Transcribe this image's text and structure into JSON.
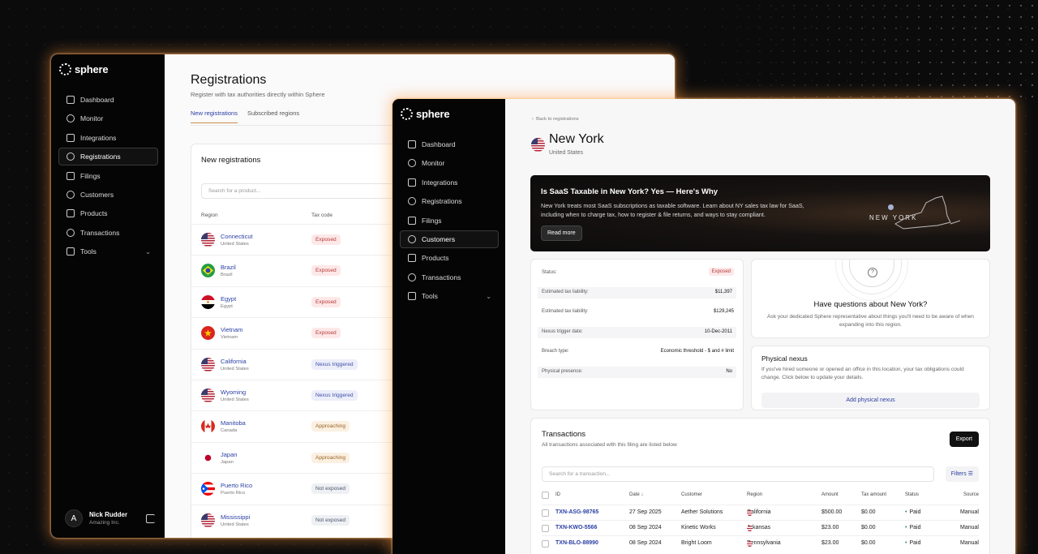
{
  "brand": {
    "name": "sphere"
  },
  "back": {
    "title": "Registrations",
    "subtitle": "Register with tax authorities directly within Sphere",
    "tabs": [
      {
        "label": "New registrations",
        "active": true
      },
      {
        "label": "Subscribed regions",
        "active": false
      }
    ],
    "card_title": "New registrations",
    "search_placeholder": "Search for a product...",
    "columns": [
      "Region",
      "Tax code"
    ],
    "rows": [
      {
        "name": "Connecticut",
        "country": "United States",
        "status": "Exposed",
        "flag": "us-flag"
      },
      {
        "name": "Brazil",
        "country": "Brazil",
        "status": "Exposed",
        "flag": "brazil-flag"
      },
      {
        "name": "Egypt",
        "country": "Egypt",
        "status": "Exposed",
        "flag": "egypt-flag"
      },
      {
        "name": "Vietnam",
        "country": "Vietnam",
        "status": "Exposed",
        "flag": "vietnam-flag"
      },
      {
        "name": "California",
        "country": "United States",
        "status": "Nexus triggered",
        "flag": "us-flag"
      },
      {
        "name": "Wyoming",
        "country": "United States",
        "status": "Nexus triggered",
        "flag": "us-flag"
      },
      {
        "name": "Manitoba",
        "country": "Canada",
        "status": "Approaching",
        "flag": "canada-flag"
      },
      {
        "name": "Japan",
        "country": "Japan",
        "status": "Approaching",
        "flag": "japan-flag"
      },
      {
        "name": "Puerto Rico",
        "country": "Puerto Rico",
        "status": "Not exposed",
        "flag": "puerto-rico-flag"
      },
      {
        "name": "Mississippi",
        "country": "United States",
        "status": "Not exposed",
        "flag": "us-flag"
      }
    ],
    "user": {
      "initial": "A",
      "name": "Nick Rudder",
      "org": "Amazing Inc."
    }
  },
  "nav_back": [
    {
      "label": "Dashboard",
      "icon": "home-icon"
    },
    {
      "label": "Monitor",
      "icon": "monitor-icon"
    },
    {
      "label": "Integrations",
      "icon": "grid-icon"
    },
    {
      "label": "Registrations",
      "icon": "location-pin-icon",
      "active": true
    },
    {
      "label": "Filings",
      "icon": "folder-icon"
    },
    {
      "label": "Customers",
      "icon": "users-icon"
    },
    {
      "label": "Products",
      "icon": "box-icon"
    },
    {
      "label": "Transactions",
      "icon": "dollar-icon"
    },
    {
      "label": "Tools",
      "icon": "wrench-icon",
      "has_chevron": true
    }
  ],
  "nav_front": [
    {
      "label": "Dashboard",
      "icon": "home-icon"
    },
    {
      "label": "Monitor",
      "icon": "monitor-icon"
    },
    {
      "label": "Integrations",
      "icon": "grid-icon"
    },
    {
      "label": "Registrations",
      "icon": "location-pin-icon"
    },
    {
      "label": "Filings",
      "icon": "folder-icon"
    },
    {
      "label": "Customers",
      "icon": "users-icon",
      "active": true
    },
    {
      "label": "Products",
      "icon": "box-icon"
    },
    {
      "label": "Transactions",
      "icon": "dollar-icon"
    },
    {
      "label": "Tools",
      "icon": "wrench-icon",
      "has_chevron": true
    }
  ],
  "front": {
    "back_link": "Back to registrations",
    "title": "New York",
    "subtitle": "United States",
    "banner": {
      "title": "Is SaaS Taxable in New York? Yes — Here's Why",
      "body": "New York treats most SaaS subscriptions as taxable software. Learn about NY sales tax law for SaaS, including when to charge tax, how to register & file returns, and ways to stay compliant.",
      "button": "Read more",
      "state_label": "NEW YORK"
    },
    "status_rows": [
      {
        "key": "Status:",
        "value": "Exposed",
        "badge": true
      },
      {
        "key": "Estimated tax liability:",
        "value": "$11,397"
      },
      {
        "key": "Estimated tax liability:",
        "value": "$129,245"
      },
      {
        "key": "Nexus trigger date:",
        "value": "10-Dec-2011"
      },
      {
        "key": "Breach type:",
        "value": "Economic threshold - $ and # limit"
      },
      {
        "key": "Physical presence:",
        "value": "No"
      }
    ],
    "help": {
      "title": "Have questions about New York?",
      "body": "Ask your dedicated Sphere representative about things you'll need to be aware of when expanding into this region."
    },
    "nexus": {
      "title": "Physical nexus",
      "body": "If you've hired someone or opened an office in this location, your tax obligations could change. Click below to update your details.",
      "button": "Add physical nexus"
    },
    "transactions": {
      "title": "Transactions",
      "subtitle": "All transactions associated with this filing are listed below",
      "export": "Export",
      "search_placeholder": "Search for a transaction...",
      "filters": "Filters",
      "columns": [
        "ID",
        "Date",
        "Customer",
        "Region",
        "Amount",
        "Tax amount",
        "Status",
        "Source"
      ],
      "rows": [
        {
          "id": "TXN-ASG-98765",
          "date": "27 Sep 2025",
          "customer": "Aether Solutions",
          "region": "California",
          "amount": "$500.00",
          "tax": "$0.00",
          "status": "Paid",
          "source": "Manual"
        },
        {
          "id": "TXN-KWO-5566",
          "date": "08 Sep 2024",
          "customer": "Kinetic Works",
          "region": "Arkansas",
          "amount": "$23.00",
          "tax": "$0.00",
          "status": "Paid",
          "source": "Manual"
        },
        {
          "id": "TXN-BLO-88990",
          "date": "08 Sep 2024",
          "customer": "Bright Loom",
          "region": "Pennsylvania",
          "amount": "$23.00",
          "tax": "$0.00",
          "status": "Paid",
          "source": "Manual"
        }
      ]
    }
  },
  "colors": {
    "accent": "#2b3fa3",
    "sidebar": "#050505",
    "glow": "#ff9a40"
  }
}
